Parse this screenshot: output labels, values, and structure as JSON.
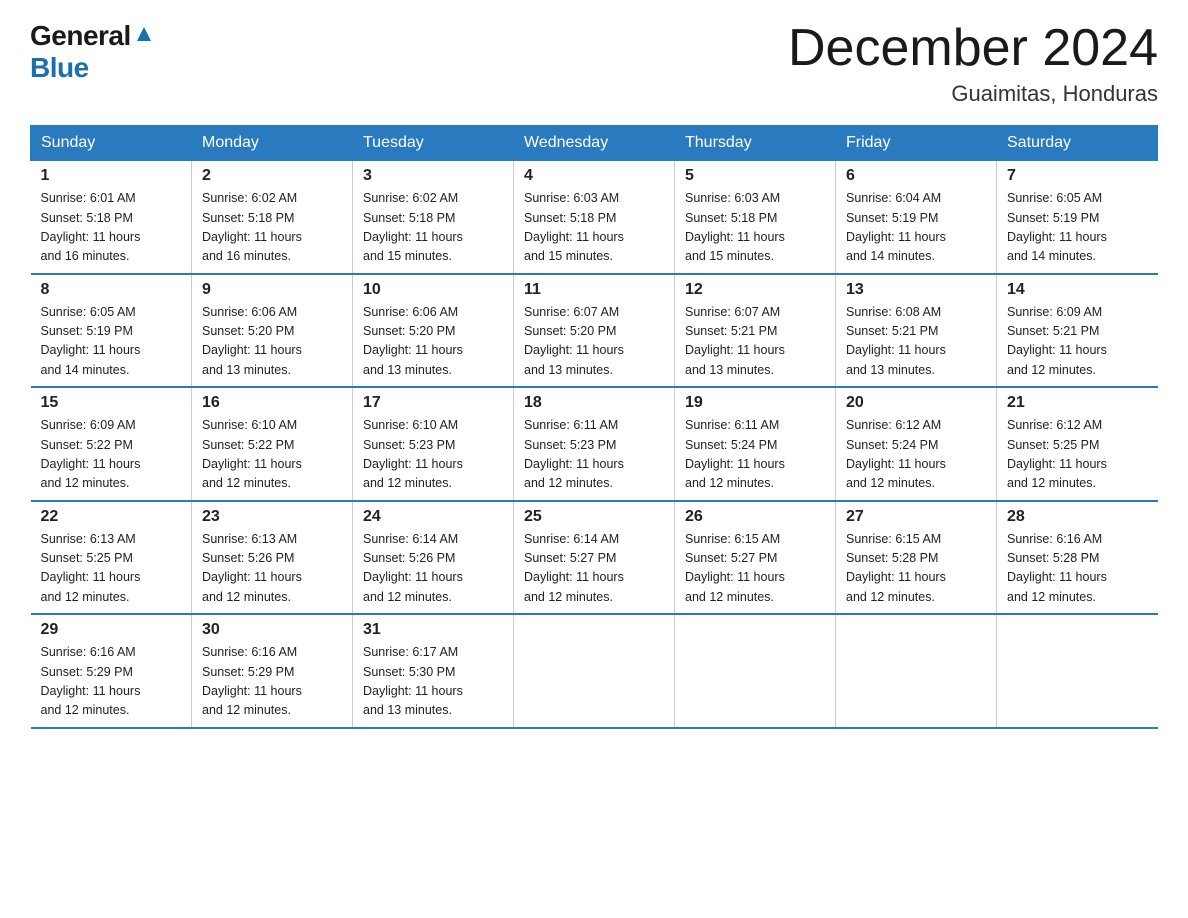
{
  "header": {
    "logo_general": "General",
    "logo_blue": "Blue",
    "month_title": "December 2024",
    "location": "Guaimitas, Honduras"
  },
  "weekdays": [
    "Sunday",
    "Monday",
    "Tuesday",
    "Wednesday",
    "Thursday",
    "Friday",
    "Saturday"
  ],
  "weeks": [
    [
      {
        "day": "1",
        "sunrise": "6:01 AM",
        "sunset": "5:18 PM",
        "daylight": "11 hours and 16 minutes."
      },
      {
        "day": "2",
        "sunrise": "6:02 AM",
        "sunset": "5:18 PM",
        "daylight": "11 hours and 16 minutes."
      },
      {
        "day": "3",
        "sunrise": "6:02 AM",
        "sunset": "5:18 PM",
        "daylight": "11 hours and 15 minutes."
      },
      {
        "day": "4",
        "sunrise": "6:03 AM",
        "sunset": "5:18 PM",
        "daylight": "11 hours and 15 minutes."
      },
      {
        "day": "5",
        "sunrise": "6:03 AM",
        "sunset": "5:18 PM",
        "daylight": "11 hours and 15 minutes."
      },
      {
        "day": "6",
        "sunrise": "6:04 AM",
        "sunset": "5:19 PM",
        "daylight": "11 hours and 14 minutes."
      },
      {
        "day": "7",
        "sunrise": "6:05 AM",
        "sunset": "5:19 PM",
        "daylight": "11 hours and 14 minutes."
      }
    ],
    [
      {
        "day": "8",
        "sunrise": "6:05 AM",
        "sunset": "5:19 PM",
        "daylight": "11 hours and 14 minutes."
      },
      {
        "day": "9",
        "sunrise": "6:06 AM",
        "sunset": "5:20 PM",
        "daylight": "11 hours and 13 minutes."
      },
      {
        "day": "10",
        "sunrise": "6:06 AM",
        "sunset": "5:20 PM",
        "daylight": "11 hours and 13 minutes."
      },
      {
        "day": "11",
        "sunrise": "6:07 AM",
        "sunset": "5:20 PM",
        "daylight": "11 hours and 13 minutes."
      },
      {
        "day": "12",
        "sunrise": "6:07 AM",
        "sunset": "5:21 PM",
        "daylight": "11 hours and 13 minutes."
      },
      {
        "day": "13",
        "sunrise": "6:08 AM",
        "sunset": "5:21 PM",
        "daylight": "11 hours and 13 minutes."
      },
      {
        "day": "14",
        "sunrise": "6:09 AM",
        "sunset": "5:21 PM",
        "daylight": "11 hours and 12 minutes."
      }
    ],
    [
      {
        "day": "15",
        "sunrise": "6:09 AM",
        "sunset": "5:22 PM",
        "daylight": "11 hours and 12 minutes."
      },
      {
        "day": "16",
        "sunrise": "6:10 AM",
        "sunset": "5:22 PM",
        "daylight": "11 hours and 12 minutes."
      },
      {
        "day": "17",
        "sunrise": "6:10 AM",
        "sunset": "5:23 PM",
        "daylight": "11 hours and 12 minutes."
      },
      {
        "day": "18",
        "sunrise": "6:11 AM",
        "sunset": "5:23 PM",
        "daylight": "11 hours and 12 minutes."
      },
      {
        "day": "19",
        "sunrise": "6:11 AM",
        "sunset": "5:24 PM",
        "daylight": "11 hours and 12 minutes."
      },
      {
        "day": "20",
        "sunrise": "6:12 AM",
        "sunset": "5:24 PM",
        "daylight": "11 hours and 12 minutes."
      },
      {
        "day": "21",
        "sunrise": "6:12 AM",
        "sunset": "5:25 PM",
        "daylight": "11 hours and 12 minutes."
      }
    ],
    [
      {
        "day": "22",
        "sunrise": "6:13 AM",
        "sunset": "5:25 PM",
        "daylight": "11 hours and 12 minutes."
      },
      {
        "day": "23",
        "sunrise": "6:13 AM",
        "sunset": "5:26 PM",
        "daylight": "11 hours and 12 minutes."
      },
      {
        "day": "24",
        "sunrise": "6:14 AM",
        "sunset": "5:26 PM",
        "daylight": "11 hours and 12 minutes."
      },
      {
        "day": "25",
        "sunrise": "6:14 AM",
        "sunset": "5:27 PM",
        "daylight": "11 hours and 12 minutes."
      },
      {
        "day": "26",
        "sunrise": "6:15 AM",
        "sunset": "5:27 PM",
        "daylight": "11 hours and 12 minutes."
      },
      {
        "day": "27",
        "sunrise": "6:15 AM",
        "sunset": "5:28 PM",
        "daylight": "11 hours and 12 minutes."
      },
      {
        "day": "28",
        "sunrise": "6:16 AM",
        "sunset": "5:28 PM",
        "daylight": "11 hours and 12 minutes."
      }
    ],
    [
      {
        "day": "29",
        "sunrise": "6:16 AM",
        "sunset": "5:29 PM",
        "daylight": "11 hours and 12 minutes."
      },
      {
        "day": "30",
        "sunrise": "6:16 AM",
        "sunset": "5:29 PM",
        "daylight": "11 hours and 12 minutes."
      },
      {
        "day": "31",
        "sunrise": "6:17 AM",
        "sunset": "5:30 PM",
        "daylight": "11 hours and 13 minutes."
      },
      null,
      null,
      null,
      null
    ]
  ],
  "labels": {
    "sunrise": "Sunrise:",
    "sunset": "Sunset:",
    "daylight": "Daylight:"
  }
}
